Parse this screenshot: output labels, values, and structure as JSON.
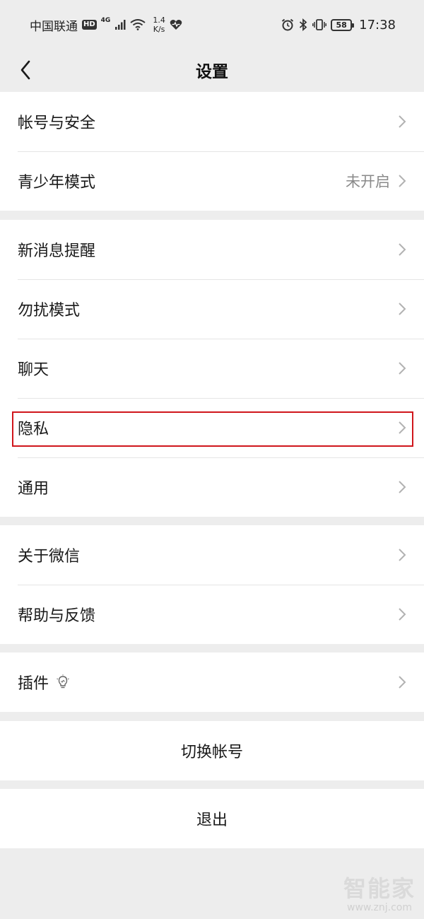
{
  "status_bar": {
    "carrier": "中国联通",
    "hd": "HD",
    "network": "4G",
    "speed_value": "1.4",
    "speed_unit": "K/s",
    "battery": "58",
    "time": "17:38"
  },
  "nav": {
    "title": "设置"
  },
  "groups": [
    {
      "items": [
        {
          "label": "帐号与安全"
        },
        {
          "label": "青少年模式",
          "value": "未开启"
        }
      ]
    },
    {
      "items": [
        {
          "label": "新消息提醒"
        },
        {
          "label": "勿扰模式"
        },
        {
          "label": "聊天"
        },
        {
          "label": "隐私",
          "highlighted": true
        },
        {
          "label": "通用"
        }
      ]
    },
    {
      "items": [
        {
          "label": "关于微信"
        },
        {
          "label": "帮助与反馈"
        }
      ]
    },
    {
      "items": [
        {
          "label": "插件",
          "icon": "lightbulb-icon"
        }
      ]
    }
  ],
  "actions": {
    "switch_account": "切换帐号",
    "logout": "退出"
  },
  "watermark": {
    "name": "智能家",
    "url": "www.znj.com"
  },
  "colors": {
    "background": "#ededed",
    "highlight_border": "#d0161c",
    "secondary_text": "#8a8a8a"
  }
}
